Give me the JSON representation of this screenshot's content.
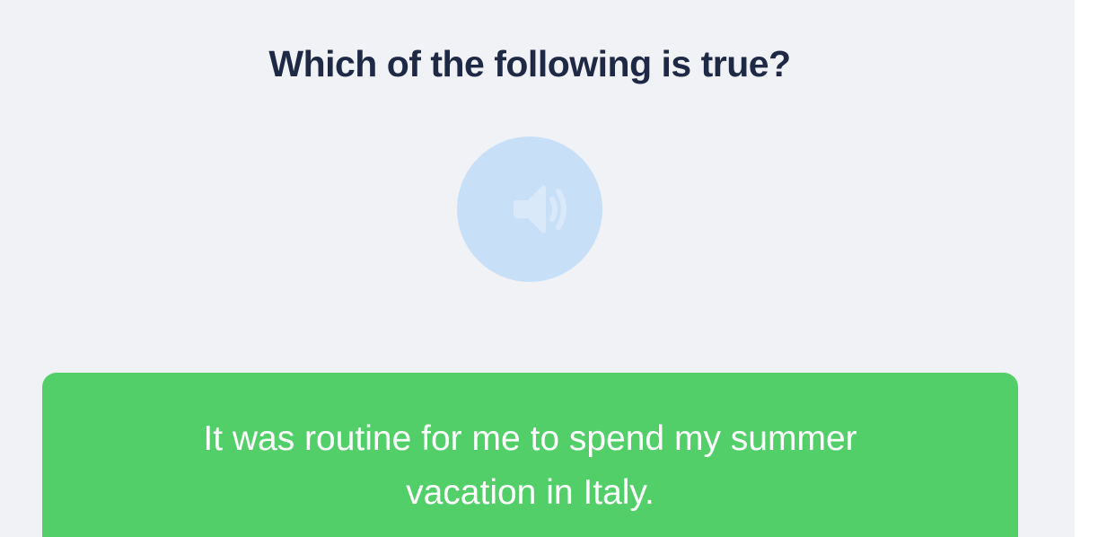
{
  "question": {
    "text": "Which of the following is true?"
  },
  "audio": {
    "icon": "speaker-icon",
    "color": "#c8e0f7"
  },
  "answer": {
    "text": "It was routine for me to spend my summer vacation in Italy.",
    "color": "#53cf6a"
  },
  "colors": {
    "background": "#f1f2f5",
    "heading": "#1e2a45"
  }
}
